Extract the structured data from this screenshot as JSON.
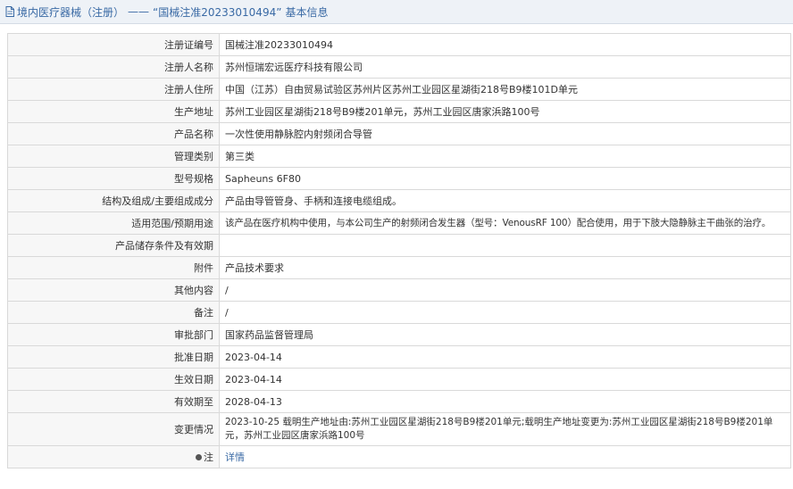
{
  "header": {
    "category": "境内医疗器械（注册）",
    "separator": "——",
    "record": "“国械注准20233010494”",
    "suffix": "基本信息"
  },
  "rows": [
    {
      "label": "注册证编号",
      "value": "国械注准20233010494"
    },
    {
      "label": "注册人名称",
      "value": "苏州恒瑞宏远医疗科技有限公司"
    },
    {
      "label": "注册人住所",
      "value": "中国（江苏）自由贸易试验区苏州片区苏州工业园区星湖街218号B9楼101D单元"
    },
    {
      "label": "生产地址",
      "value": "苏州工业园区星湖街218号B9楼201单元，苏州工业园区唐家浜路100号"
    },
    {
      "label": "产品名称",
      "value": "一次性使用静脉腔内射频闭合导管"
    },
    {
      "label": "管理类别",
      "value": "第三类"
    },
    {
      "label": "型号规格",
      "value": "Sapheuns 6F80"
    },
    {
      "label": "结构及组成/主要组成成分",
      "value": "产品由导管管身、手柄和连接电缆组成。"
    },
    {
      "label": "适用范围/预期用途",
      "value": "该产品在医疗机构中使用，与本公司生产的射频闭合发生器（型号：VenousRF 100）配合使用，用于下肢大隐静脉主干曲张的治疗。"
    },
    {
      "label": "产品储存条件及有效期",
      "value": ""
    },
    {
      "label": "附件",
      "value": "产品技术要求"
    },
    {
      "label": "其他内容",
      "value": "/"
    },
    {
      "label": "备注",
      "value": "/"
    },
    {
      "label": "审批部门",
      "value": "国家药品监督管理局"
    },
    {
      "label": "批准日期",
      "value": "2023-04-14"
    },
    {
      "label": "生效日期",
      "value": "2023-04-14"
    },
    {
      "label": "有效期至",
      "value": "2028-04-13"
    },
    {
      "label": "变更情况",
      "value": "2023-10-25 载明生产地址由:苏州工业园区星湖街218号B9楼201单元;载明生产地址变更为:苏州工业园区星湖街218号B9楼201单元，苏州工业园区唐家浜路100号"
    }
  ],
  "note_row": {
    "label": "注",
    "icon": "pin-icon",
    "link": "详情"
  },
  "colors": {
    "link": "#3a6aa5",
    "border": "#d9d9d9",
    "header_bg": "#eef2f7"
  }
}
